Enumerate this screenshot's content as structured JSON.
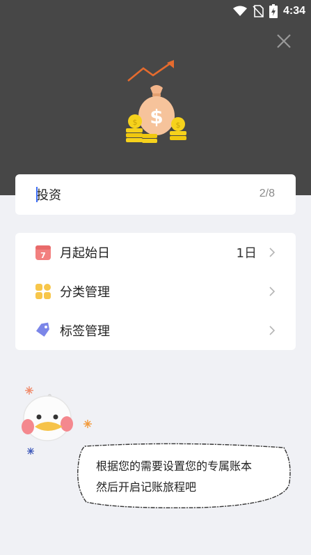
{
  "status_bar": {
    "time": "4:34",
    "icons": [
      "wifi-icon",
      "no-sim-icon",
      "battery-charging-icon"
    ]
  },
  "header": {
    "close_icon": "close-icon",
    "illustration": "money-bag-growth-illustration"
  },
  "account_name": {
    "value": "投资",
    "counter": "2/8"
  },
  "settings": {
    "items": [
      {
        "label": "月起始日",
        "value": "1日",
        "icon": "calendar-icon",
        "icon_text": "7",
        "color": "#f2807f"
      },
      {
        "label": "分类管理",
        "value": "",
        "icon": "category-grid-icon",
        "color": "#f7c64a"
      },
      {
        "label": "标签管理",
        "value": "",
        "icon": "tag-icon",
        "color": "#7b86e8"
      }
    ]
  },
  "tip": {
    "line1": "根据您的需要设置您的专属账本",
    "line2": "然后开启记账旅程吧"
  },
  "colors": {
    "header_bg": "#474747",
    "page_bg": "#f0f1f5",
    "accent_orange": "#e56b2e",
    "coin_yellow": "#f6d21c"
  }
}
